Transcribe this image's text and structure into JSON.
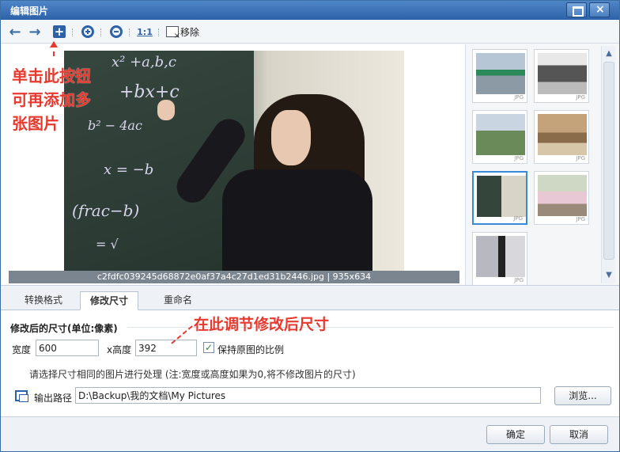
{
  "window": {
    "title": "编辑图片"
  },
  "toolbar": {
    "ratio_label": "1:1",
    "remove_label": "移除"
  },
  "preview": {
    "caption": "c2fdfc039245d68872e0af37a4c27d1ed31b2446.jpg | 935x634"
  },
  "annotations": {
    "add_hint_lines": [
      "单击此按钮",
      "可再添加多",
      "张图片"
    ],
    "size_hint": "在此调节修改后尺寸"
  },
  "thumbnails": [
    {
      "ext": "JPG",
      "selected": false
    },
    {
      "ext": "JPG",
      "selected": false
    },
    {
      "ext": "JPG",
      "selected": false
    },
    {
      "ext": "JPG",
      "selected": false
    },
    {
      "ext": "JPG",
      "selected": true
    },
    {
      "ext": "JPG",
      "selected": false
    },
    {
      "ext": "JPG",
      "selected": false
    }
  ],
  "tabs": [
    "转换格式",
    "修改尺寸",
    "重命名"
  ],
  "resize": {
    "section_title": "修改后的尺寸(单位:像素)",
    "width_label": "宽度",
    "width_value": "600",
    "height_label": "x高度",
    "height_value": "392",
    "keep_ratio_label": "保持原图的比例",
    "keep_ratio_checked": true,
    "hint": "请选择尺寸相同的图片进行处理 (注:宽度或高度如果为0,将不修改图片的尺寸)",
    "output_label": "输出路径",
    "output_path": "D:\\Backup\\我的文档\\My Pictures",
    "browse_label": "浏览..."
  },
  "footer": {
    "ok_label": "确定",
    "cancel_label": "取消"
  }
}
